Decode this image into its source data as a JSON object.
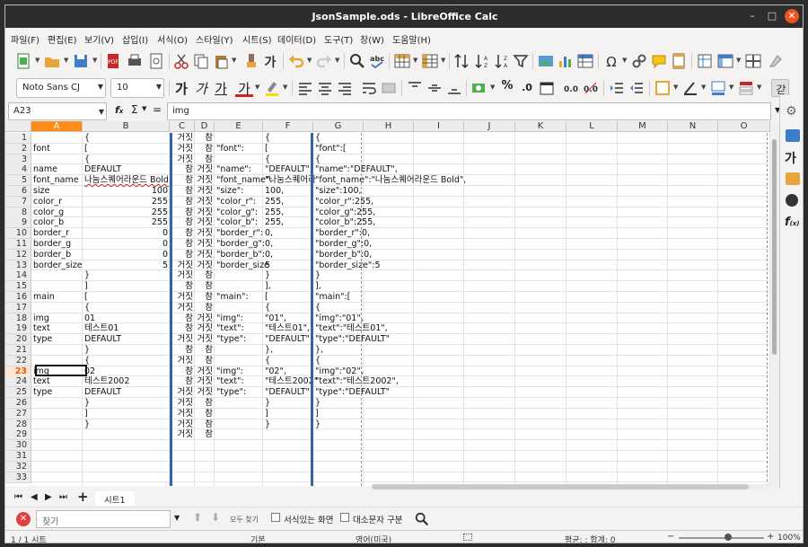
{
  "window": {
    "title": "JsonSample.ods - LibreOffice Calc"
  },
  "menu": [
    "파일(F)",
    "편집(E)",
    "보기(V)",
    "삽입(I)",
    "서식(O)",
    "스타일(Y)",
    "시트(S)",
    "데이터(D)",
    "도구(T)",
    "창(W)",
    "도움말(H)"
  ],
  "toolbar": {
    "font_name": "Noto Sans CJ",
    "font_size": "10",
    "bold": "가",
    "italic": "가",
    "underline": "가",
    "fontcolor": "가",
    "percent": "%",
    "decimals": ".0",
    "currency_icon": "coin-icon"
  },
  "formula": {
    "cell_ref": "A23",
    "content": "img",
    "fx": "f",
    "sum": "Σ",
    "eq": "="
  },
  "grid": {
    "columns": [
      "A",
      "B",
      "C",
      "D",
      "E",
      "F",
      "G",
      "H",
      "I",
      "J",
      "K",
      "L",
      "M",
      "N",
      "O"
    ],
    "rows": [
      "1",
      "2",
      "3",
      "4",
      "5",
      "6",
      "7",
      "8",
      "9",
      "10",
      "11",
      "12",
      "13",
      "14",
      "15",
      "16",
      "17",
      "18",
      "19",
      "20",
      "21",
      "22",
      "23",
      "24",
      "25",
      "26",
      "27",
      "28",
      "29",
      "30",
      "31",
      "32",
      "33"
    ],
    "data": [
      [
        "",
        "{",
        "거짓",
        "참",
        "",
        "{",
        "{"
      ],
      [
        "font",
        "[",
        "거짓",
        "참",
        "\"font\":",
        "[",
        "\"font\":["
      ],
      [
        "",
        "{",
        "거짓",
        "참",
        "",
        "{",
        "{"
      ],
      [
        "name",
        "DEFAULT",
        "참",
        "거짓",
        "\"name\":",
        "\"DEFAULT\",",
        "\"name\":\"DEFAULT\","
      ],
      [
        "font_name",
        "나눔스퀘어라운드 Bold",
        "참",
        "거짓",
        "\"font_name\":",
        "\"나눔스퀘어라",
        "\"font_name\":\"나눔스퀘어라운드 Bold\","
      ],
      [
        "size",
        "100",
        "참",
        "거짓",
        "\"size\":",
        "100,",
        "\"size\":100,"
      ],
      [
        "color_r",
        "255",
        "참",
        "거짓",
        "\"color_r\":",
        "255,",
        "\"color_r\":255,"
      ],
      [
        "color_g",
        "255",
        "참",
        "거짓",
        "\"color_g\":",
        "255,",
        "\"color_g\":255,"
      ],
      [
        "color_b",
        "255",
        "참",
        "거짓",
        "\"color_b\":",
        "255,",
        "\"color_b\":255,"
      ],
      [
        "border_r",
        "0",
        "참",
        "거짓",
        "\"border_r\":",
        "0,",
        "\"border_r\":0,"
      ],
      [
        "border_g",
        "0",
        "참",
        "거짓",
        "\"border_g\":",
        "0,",
        "\"border_g\":0,"
      ],
      [
        "border_b",
        "0",
        "참",
        "거짓",
        "\"border_b\":",
        "0,",
        "\"border_b\":0,"
      ],
      [
        "border_size",
        "5",
        "거짓",
        "거짓",
        "\"border_size",
        "5",
        "\"border_size\":5"
      ],
      [
        "",
        "}",
        "거짓",
        "참",
        "",
        "}",
        "}"
      ],
      [
        "",
        "]",
        "참",
        "참",
        "",
        "],",
        "],"
      ],
      [
        "main",
        "[",
        "거짓",
        "참",
        "\"main\":",
        "[",
        "\"main\":["
      ],
      [
        "",
        "{",
        "거짓",
        "참",
        "",
        "{",
        "{"
      ],
      [
        "img",
        "01",
        "참",
        "거짓",
        "\"img\":",
        "\"01\",",
        "\"img\":\"01\","
      ],
      [
        "text",
        "테스트01",
        "참",
        "거짓",
        "\"text\":",
        "\"테스트01\",",
        "\"text\":\"테스트01\","
      ],
      [
        "type",
        "DEFAULT",
        "거짓",
        "거짓",
        "\"type\":",
        "\"DEFAULT\"",
        "\"type\":\"DEFAULT\""
      ],
      [
        "",
        "}",
        "참",
        "참",
        "",
        "},",
        "},"
      ],
      [
        "",
        "{",
        "거짓",
        "참",
        "",
        "{",
        "{"
      ],
      [
        "img",
        "02",
        "참",
        "거짓",
        "\"img\":",
        "\"02\",",
        "\"img\":\"02\","
      ],
      [
        "text",
        "테스트2002",
        "참",
        "거짓",
        "\"text\":",
        "\"테스트2002\"",
        "\"text\":\"테스트2002\","
      ],
      [
        "type",
        "DEFAULT",
        "거짓",
        "거짓",
        "\"type\":",
        "\"DEFAULT\"",
        "\"type\":\"DEFAULT\""
      ],
      [
        "",
        "}",
        "거짓",
        "참",
        "",
        "}",
        "}"
      ],
      [
        "",
        "]",
        "거짓",
        "참",
        "",
        "]",
        "]"
      ],
      [
        "",
        "}",
        "거짓",
        "참",
        "",
        "}",
        "}"
      ],
      [
        "",
        "",
        "거짓",
        "참",
        "",
        "",
        ""
      ]
    ]
  },
  "sheets": {
    "tab": "시트1"
  },
  "find": {
    "placeholder": "찾기",
    "find_all": "모두 찾기",
    "formatted": "서식있는 화면",
    "match_case": "대소문자 구분"
  },
  "status": {
    "sheet": "1 / 1 시트",
    "style": "기본",
    "lang": "영어(미국)",
    "stats": "평균: ; 합계: 0",
    "zoom": "100%",
    "zoom_minus": "−",
    "zoom_plus": "+"
  }
}
